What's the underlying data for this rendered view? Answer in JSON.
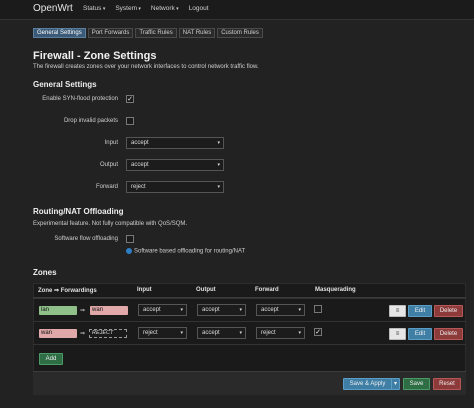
{
  "header": {
    "brand": "OpenWrt",
    "menu": [
      {
        "label": "Status"
      },
      {
        "label": "System"
      },
      {
        "label": "Network"
      },
      {
        "label": "Logout"
      }
    ]
  },
  "tabs": [
    {
      "label": "General Settings",
      "active": true
    },
    {
      "label": "Port Forwards"
    },
    {
      "label": "Traffic Rules"
    },
    {
      "label": "NAT Rules"
    },
    {
      "label": "Custom Rules"
    }
  ],
  "page": {
    "title": "Firewall - Zone Settings",
    "description": "The firewall creates zones over your network interfaces to control network traffic flow."
  },
  "general": {
    "heading": "General Settings",
    "syn_flood_label": "Enable SYN-flood protection",
    "syn_flood_checked": true,
    "drop_invalid_label": "Drop invalid packets",
    "drop_invalid_checked": false,
    "input_label": "Input",
    "input_value": "accept",
    "output_label": "Output",
    "output_value": "accept",
    "forward_label": "Forward",
    "forward_value": "reject"
  },
  "offload": {
    "heading": "Routing/NAT Offloading",
    "description": "Experimental feature. Not fully compatible with QoS/SQM.",
    "sw_label": "Software flow offloading",
    "sw_checked": false,
    "sw_note": "Software based offloading for routing/NAT"
  },
  "zones": {
    "heading": "Zones",
    "columns": {
      "zone": "Zone ⇒ Forwardings",
      "input": "Input",
      "output": "Output",
      "forward": "Forward",
      "masq": "Masquerading"
    },
    "rows": [
      {
        "zone": "lan",
        "zone_color": "#90c08a",
        "arrow": "⇒",
        "dest": "wan",
        "dest_color": "#e0a8a8",
        "input": "accept",
        "output": "accept",
        "forward": "accept",
        "masq": false
      },
      {
        "zone": "wan",
        "zone_color": "#e0a8a8",
        "arrow": "⇒",
        "dest": "REJECT",
        "input": "reject",
        "output": "accept",
        "forward": "reject",
        "masq": true
      }
    ],
    "drag_label": "≡",
    "edit_label": "Edit",
    "delete_label": "Delete",
    "add_label": "Add"
  },
  "footer": {
    "save_apply_label": "Save & Apply",
    "save_apply_menu": "▾",
    "save_label": "Save",
    "reset_label": "Reset"
  },
  "colors": {
    "edit_blue": "#3f7fa6",
    "delete_red": "#8d3a3a",
    "add_green": "#2f6e45"
  }
}
